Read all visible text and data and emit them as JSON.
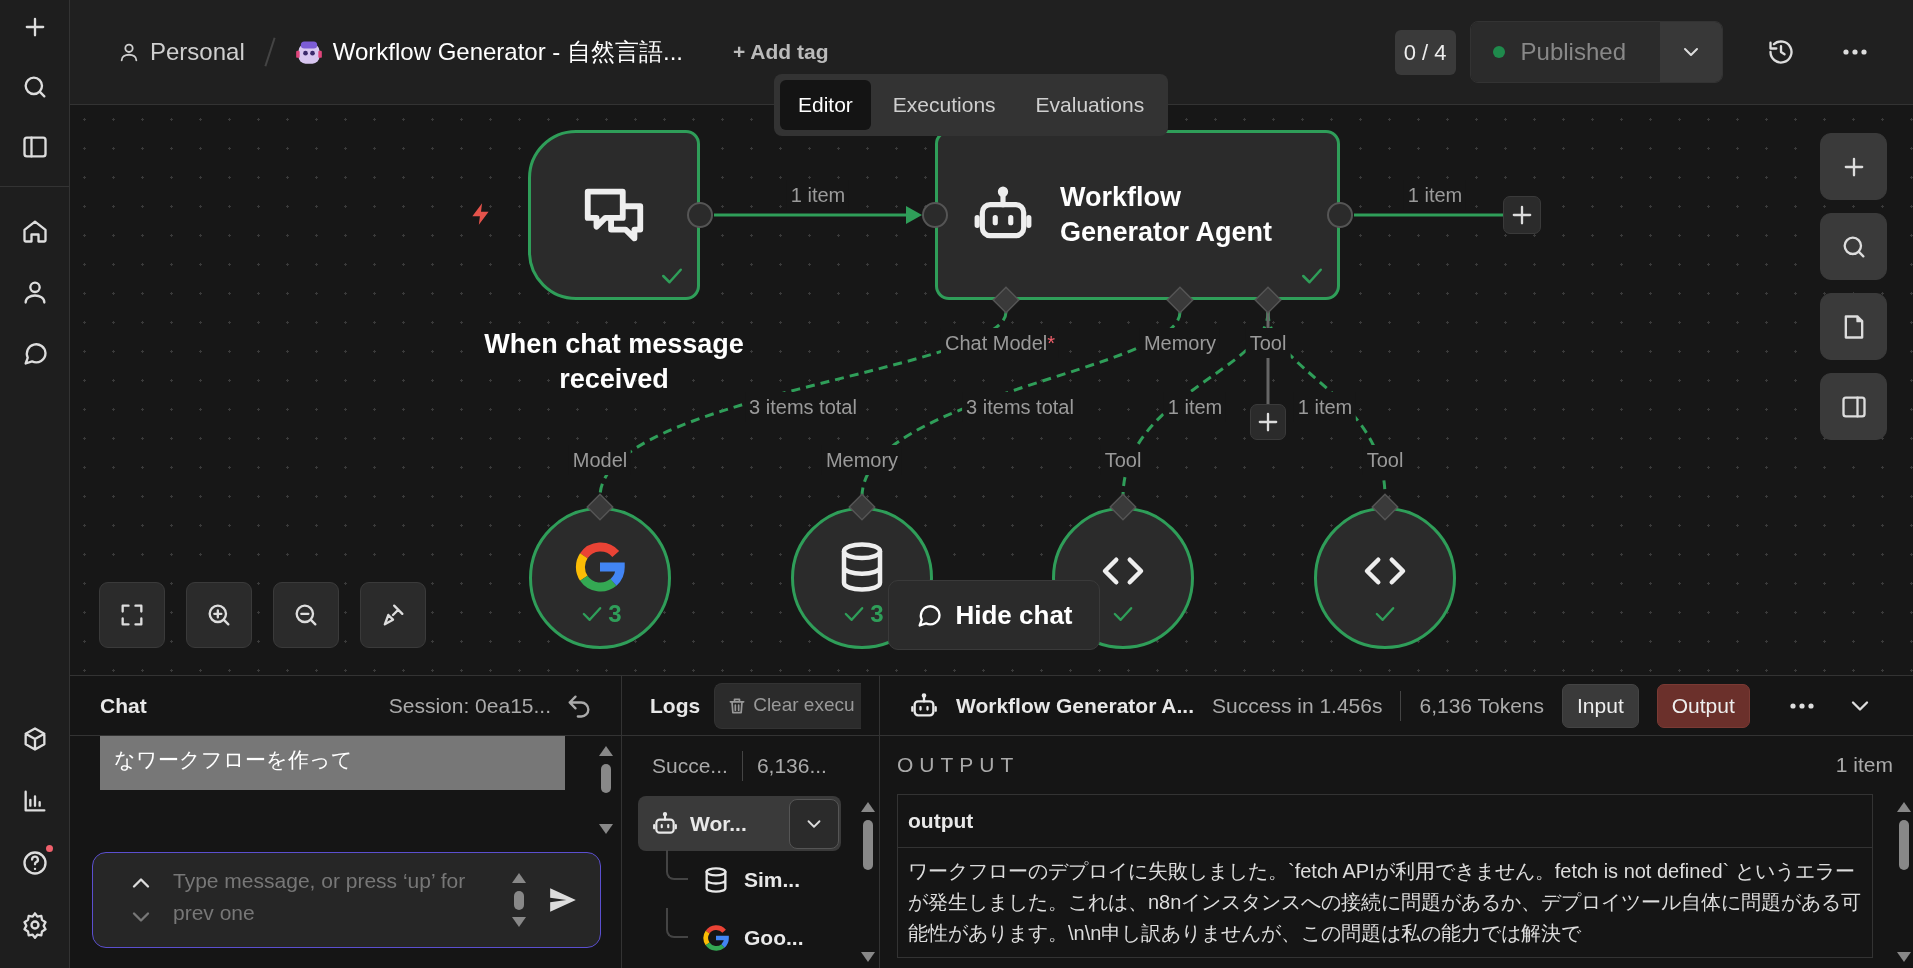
{
  "sidebar": {
    "help_notification": true
  },
  "header": {
    "project": "Personal",
    "workflow_title": "Workflow Generator - 自然言語...",
    "add_tag": "+ Add tag",
    "version_count": "0 / 4",
    "publish_status": "Published",
    "published": true
  },
  "tabs": [
    {
      "label": "Editor",
      "selected": true
    },
    {
      "label": "Executions",
      "selected": false
    },
    {
      "label": "Evaluations",
      "selected": false
    }
  ],
  "canvas": {
    "nodes": [
      {
        "kind": "trigger",
        "name": "When chat message received",
        "success": true
      },
      {
        "kind": "agent",
        "name": "Workflow Generator Agent",
        "success": true
      }
    ],
    "main_edges": [
      {
        "label": "1 item"
      },
      {
        "label": "1 item"
      }
    ],
    "agent_ports": [
      {
        "label": "Chat Model",
        "required_mark": "*"
      },
      {
        "label": "Memory"
      },
      {
        "label": "Tool"
      }
    ],
    "sub_nodes": [
      {
        "kind": "gemini",
        "port_label": "Model",
        "edge_label": "3 items total",
        "success": true,
        "count": "3"
      },
      {
        "kind": "memory",
        "port_label": "Memory",
        "edge_label": "3 items total",
        "success": true,
        "count": "3"
      },
      {
        "kind": "code",
        "port_label": "Tool",
        "edge_label": "1 item",
        "success": true
      },
      {
        "kind": "code",
        "port_label": "Tool",
        "edge_label": "1 item",
        "success": true
      }
    ],
    "hide_chat": "Hide chat"
  },
  "chat": {
    "title": "Chat",
    "session": "Session: 0ea15...",
    "messages": [
      {
        "kind": "user",
        "text": "なワークフローを作って"
      }
    ],
    "input": {
      "placeholder": "Type message, or press ‘up’ for prev one"
    }
  },
  "logs": {
    "title": "Logs",
    "clear_button": "Clear execu",
    "status": "Succe...",
    "tokens": "6,136...",
    "tree": [
      {
        "label": "Wor...",
        "kind": "agent",
        "selected": true,
        "children": [
          {
            "label": "Sim...",
            "kind": "memory",
            "selected": false
          },
          {
            "label": "Goo...",
            "kind": "gemini",
            "selected": false
          }
        ]
      }
    ]
  },
  "output_panel": {
    "node_name": "Workflow Generator A...",
    "status": "Success in 1.456s",
    "tokens": "6,136 Tokens",
    "views": [
      {
        "label": "Input",
        "selected": false
      },
      {
        "label": "Output",
        "selected": true
      }
    ],
    "section_title": "OUTPUT",
    "item_count": "1 item",
    "table": {
      "columns": [
        "output"
      ],
      "rows": [
        [
          "ワークフローのデプロイに失敗しました。`fetch APIが利用できません。fetch is not defined` というエラーが発生しました。これは、n8nインスタンスへの接続に問題があるか、デプロイツール自体に問題がある可能性があります。\\n\\n申し訳ありませんが、この問題は私の能力では解決で"
        ]
      ]
    }
  }
}
